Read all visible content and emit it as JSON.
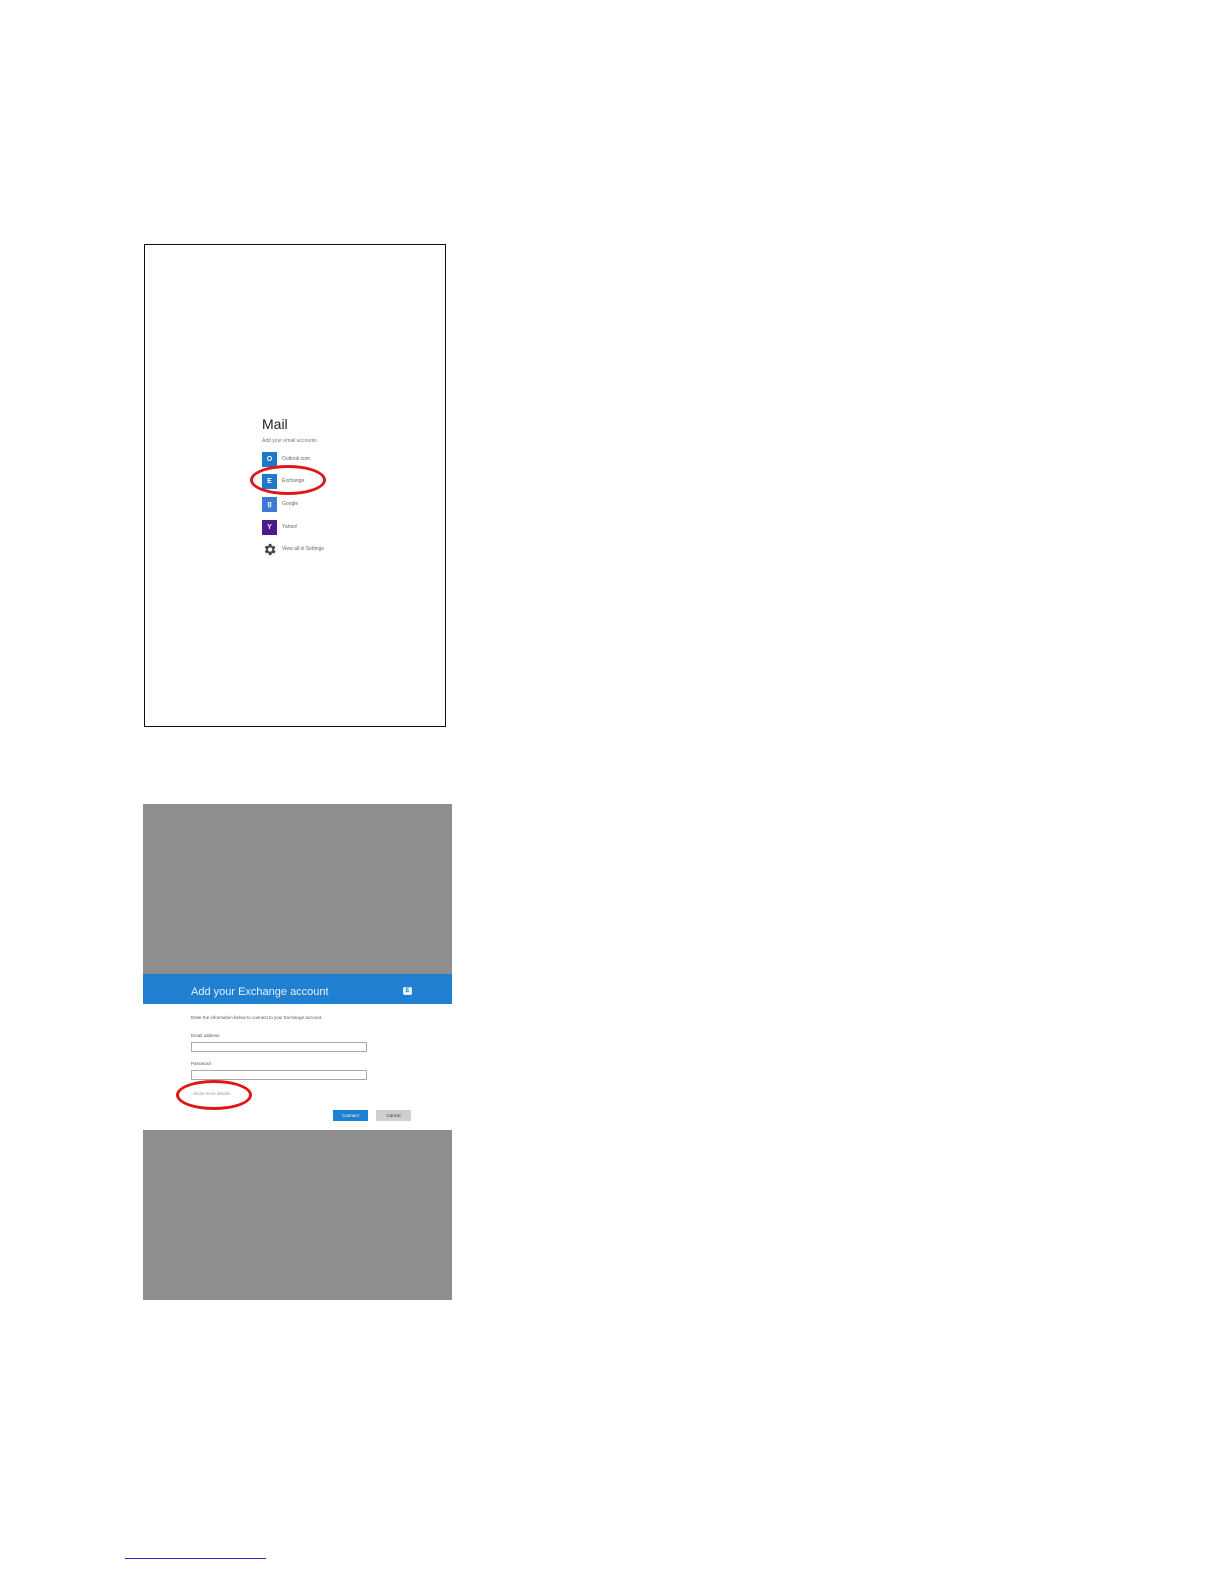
{
  "mail_screen": {
    "title": "Mail",
    "subtitle": "Add your email accounts",
    "accounts": [
      {
        "label": "Outlook.com",
        "icon": "outlook-icon",
        "color": "#1f78c8"
      },
      {
        "label": "Exchange",
        "icon": "exchange-icon",
        "color": "#1f78c8"
      },
      {
        "label": "Google",
        "icon": "google-icon",
        "color": "#3b79d6"
      },
      {
        "label": "Yahoo!",
        "icon": "yahoo-icon",
        "color": "#4b1a8c"
      },
      {
        "label": "View all in Settings",
        "icon": "gear-icon"
      }
    ]
  },
  "exchange_dialog": {
    "title": "Add your Exchange account",
    "intro": "Enter the information below to connect to your Exchange account.",
    "email_label": "Email address",
    "email_value": "",
    "password_label": "Password",
    "password_value": "",
    "advanced_link": "Show more details",
    "connect_label": "Connect",
    "cancel_label": "Cancel",
    "accent": "#1f7fd0"
  },
  "annotation": {
    "highlight_color": "#e01515"
  }
}
